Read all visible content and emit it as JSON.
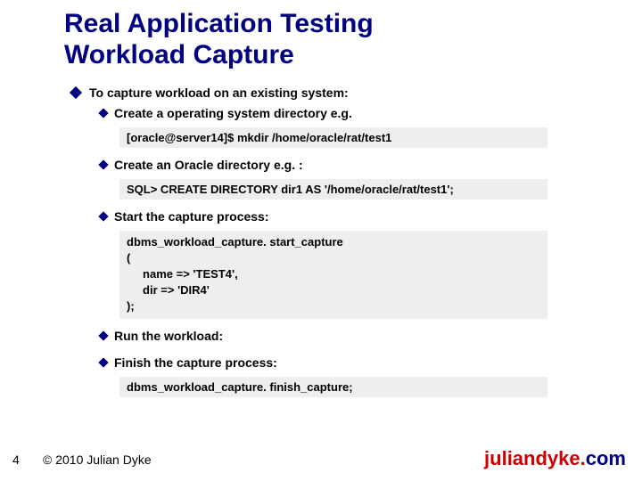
{
  "title_line1": "Real Application Testing",
  "title_line2": "Workload Capture",
  "bullets": {
    "main": "To capture workload on an existing system:",
    "sub1": "Create a operating system directory e.g.",
    "code1": "[oracle@server14]$ mkdir /home/oracle/rat/test1",
    "sub2": "Create an Oracle directory e.g. :",
    "code2": "SQL> CREATE DIRECTORY dir1 AS '/home/oracle/rat/test1';",
    "sub3": "Start the capture process:",
    "code3": "dbms_workload_capture. start_capture\n(\n     name => 'TEST4',\n     dir => 'DIR4'\n);",
    "sub4": "Run the workload:",
    "sub5": "Finish the capture process:",
    "code5": "dbms_workload_capture. finish_capture;"
  },
  "footer": {
    "page": "4",
    "copyright": "© 2010 Julian Dyke",
    "site_part1": "juliandyke.",
    "site_part2": "com"
  }
}
